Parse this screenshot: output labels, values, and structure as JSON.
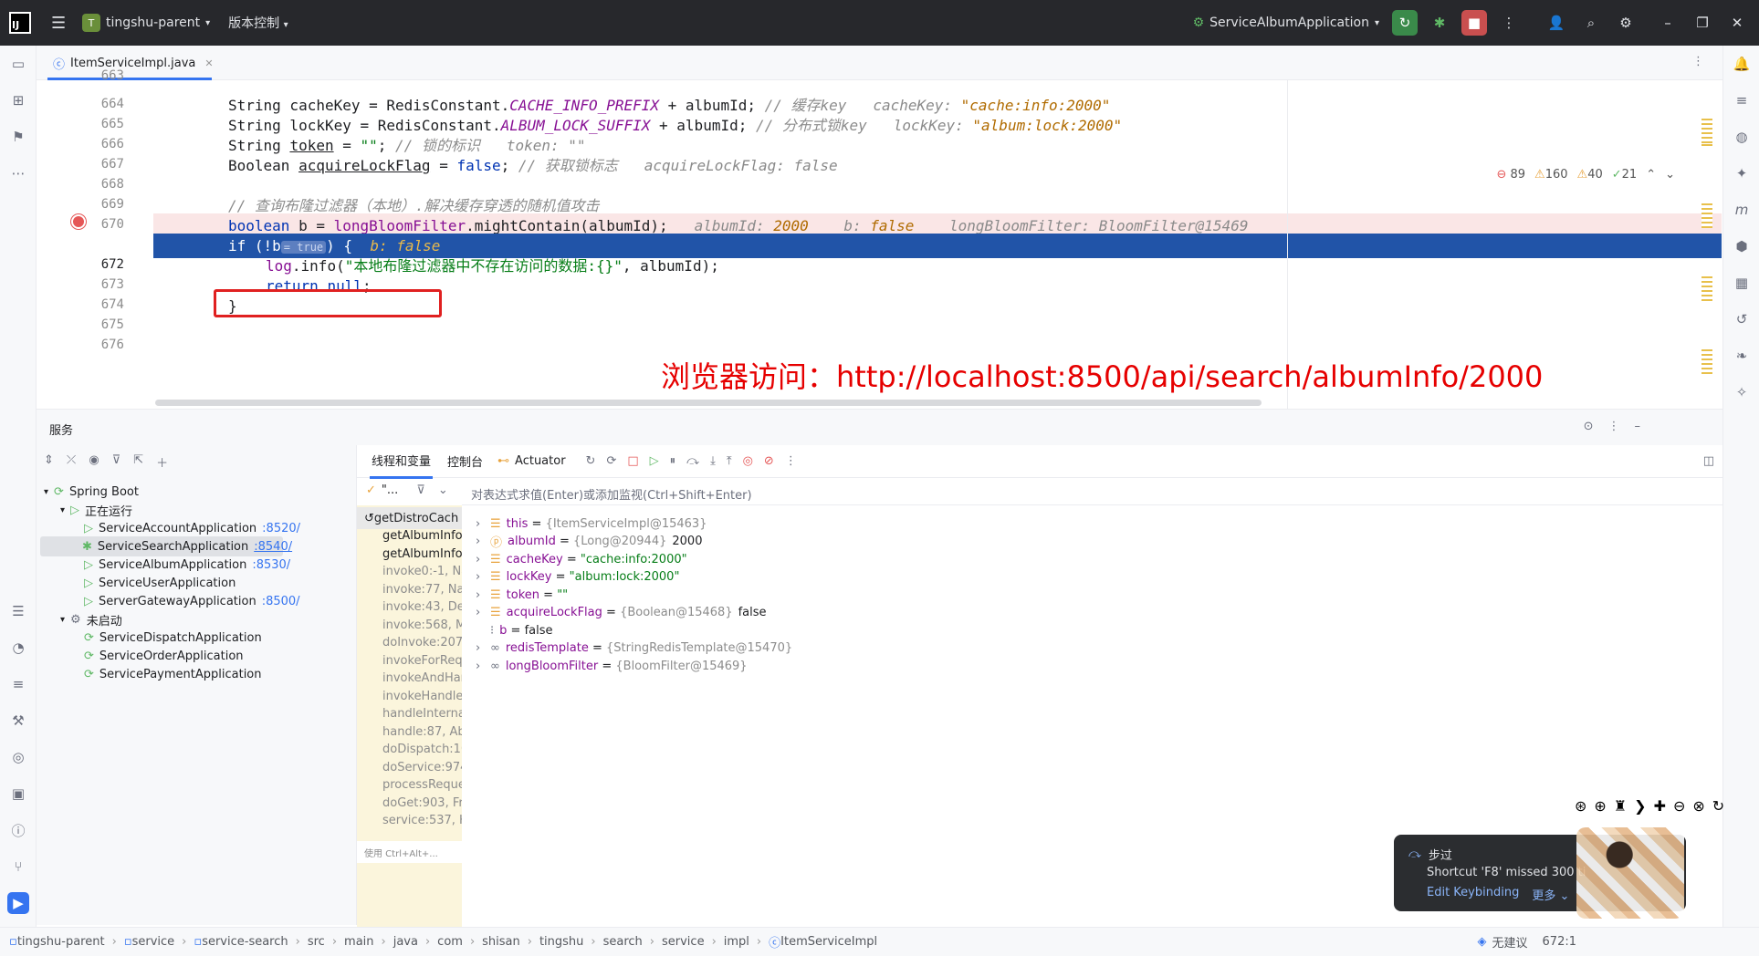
{
  "titlebar": {
    "logo": "IJ",
    "project_badge": "T",
    "project_name": "tingshu-parent",
    "vcs_menu": "版本控制",
    "run_config": "ServiceAlbumApplication"
  },
  "editor_tab": {
    "label": "ItemServiceImpl.java"
  },
  "inspections": {
    "errors": "89",
    "warnings": "160",
    "weak_warnings": "40",
    "ok": "21"
  },
  "code": {
    "line_numbers": [
      "664",
      "665",
      "666",
      "667",
      "668",
      "669",
      "670",
      "",
      "672",
      "673",
      "674",
      "675",
      "676"
    ],
    "l665": {
      "a": "String cacheKey = RedisConstant.",
      "f": "CACHE_INFO_PREFIX",
      "b": " + albumId; ",
      "c": "// 缓存key",
      "h1": "cacheKey: ",
      "h2": "\"cache:info:2000\""
    },
    "l666": {
      "a": "String lockKey = RedisConstant.",
      "f": "ALBUM_LOCK_SUFFIX",
      "b": " + albumId; ",
      "c": "// 分布式锁key",
      "h1": "lockKey: ",
      "h2": "\"album:lock:2000\""
    },
    "l667": {
      "a": "String ",
      "v": "token",
      "b": " = ",
      "s": "\"\"",
      "e": "; ",
      "c": "// 锁的标识",
      "h": "token: \"\""
    },
    "l668": {
      "a": "Boolean ",
      "v": "acquireLockFlag",
      "b": " = ",
      "k": "false",
      "e": "; ",
      "c": "// 获取锁标志",
      "h": "acquireLockFlag: false"
    },
    "l670": {
      "c": "// 查询布隆过滤器（本地）.解决缓存穿透的随机值攻击"
    },
    "l671": {
      "k": "boolean",
      "a": " b = ",
      "f": "longBloomFilter",
      "b": ".mightContain(albumId);",
      "h1": "albumId: ",
      "h1v": "2000",
      "h2": "b: ",
      "h2v": "false",
      "h3": "longBloomFilter: BloomFilter@15469"
    },
    "l672": {
      "a": "if (!b",
      "chip": "= true",
      "b": ") {",
      "h": "b: false"
    },
    "l673": {
      "f": "log",
      "a": ".info(",
      "s": "\"本地布隆过滤器中不存在访问的数据:{}\"",
      "b": ", albumId);"
    },
    "l674": {
      "k": "return",
      "k2": "null",
      "e": ";"
    },
    "l675": {
      "a": "}"
    }
  },
  "annotation": "浏览器访问：http://localhost:8500/api/search/albumInfo/2000",
  "services": {
    "title": "服务",
    "root": "Spring Boot",
    "running_group": "正在运行",
    "running": [
      {
        "name": "ServiceAccountApplication",
        "port": ":8520/"
      },
      {
        "name": "ServiceSearchApplication",
        "port": ":8540/"
      },
      {
        "name": "ServiceAlbumApplication",
        "port": ":8530/"
      },
      {
        "name": "ServiceUserApplication",
        "port": ""
      },
      {
        "name": "ServerGatewayApplication",
        "port": ":8500/"
      }
    ],
    "stopped_group": "未启动",
    "stopped": [
      {
        "name": "ServiceDispatchApplication"
      },
      {
        "name": "ServiceOrderApplication"
      },
      {
        "name": "ServicePaymentApplication"
      }
    ]
  },
  "debugger": {
    "tabs": [
      "线程和变量",
      "控制台",
      "Actuator"
    ],
    "thread_filter": "\"...",
    "eval_placeholder": "对表达式求值(Enter)或添加监视(Ctrl+Shift+Enter)",
    "frames": [
      "getDistroCach",
      "getAlbumInfo:",
      "getAlbumInfo:",
      "invoke0:-1, Na",
      "invoke:77, Nat",
      "invoke:43, De",
      "invoke:568, M",
      "doInvoke:207,",
      "invokeForReq",
      "invokeAndHar",
      "invokeHandle",
      "handleInterna",
      "handle:87, Ab",
      "doDispatch:10",
      "doService:974",
      "processReque",
      "doGet:903, Fr",
      "service:537, H"
    ],
    "frames_hint": "使用 Ctrl+Alt+...",
    "variables": [
      {
        "name": "this",
        "eq": " = ",
        "type": "{ItemServiceImpl@15463}",
        "val": ""
      },
      {
        "name": "albumId",
        "eq": " = ",
        "type": "{Long@20944}",
        "val": "2000"
      },
      {
        "name": "cacheKey",
        "eq": " = ",
        "type": "",
        "val": "\"cache:info:2000\""
      },
      {
        "name": "lockKey",
        "eq": " = ",
        "type": "",
        "val": "\"album:lock:2000\""
      },
      {
        "name": "token",
        "eq": " = ",
        "type": "",
        "val": "\"\""
      },
      {
        "name": "acquireLockFlag",
        "eq": " = ",
        "type": "{Boolean@15468}",
        "val": "false"
      },
      {
        "name": "b",
        "eq": " = ",
        "type": "",
        "val": "false"
      },
      {
        "name": "redisTemplate",
        "eq": " = ",
        "type": "{StringRedisTemplate@15470}",
        "val": ""
      },
      {
        "name": "longBloomFilter",
        "eq": " = ",
        "type": "{BloomFilter@15469}",
        "val": ""
      }
    ]
  },
  "toast": {
    "title": "步过",
    "message": "Shortcut 'F8' missed 300 ti",
    "edit": "Edit Keybinding",
    "more": "更多"
  },
  "statusbar": {
    "crumbs": [
      "tingshu-parent",
      "service",
      "service-search",
      "src",
      "main",
      "java",
      "com",
      "shisan",
      "tingshu",
      "search",
      "service",
      "impl",
      "ItemServiceImpl"
    ],
    "right": "无建议",
    "pos": "672:1"
  },
  "colors": {
    "accent": "#3574f0",
    "current_line": "#2154a8",
    "breakpoint_line": "#fae6e6",
    "annotation_red": "#e60000"
  }
}
